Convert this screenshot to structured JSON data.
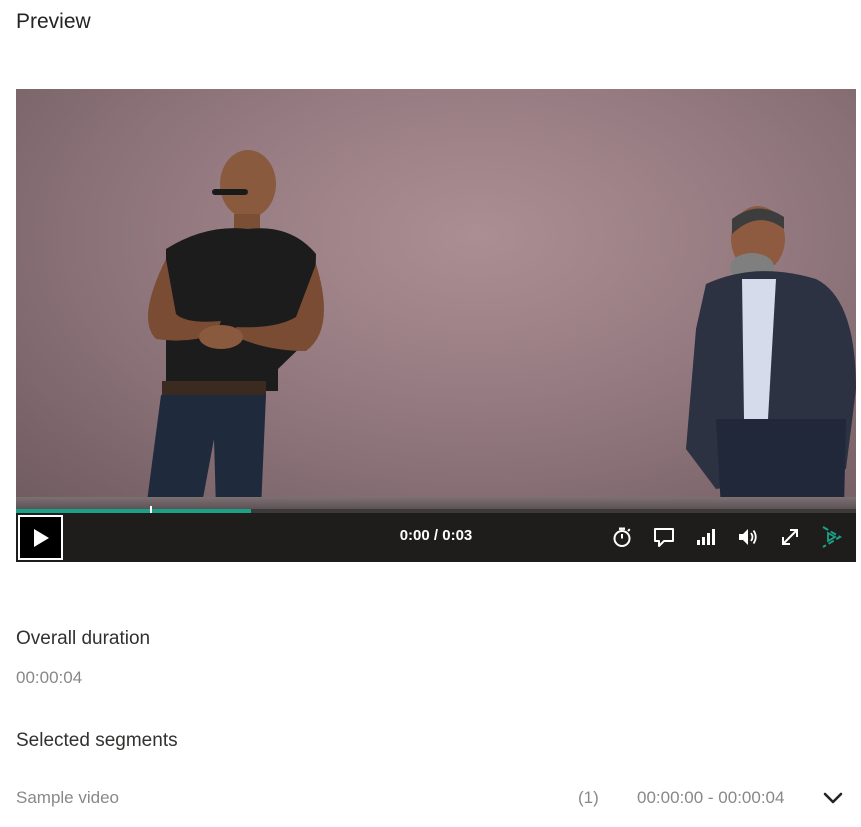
{
  "page": {
    "title": "Preview"
  },
  "player": {
    "time_display": "0:00 / 0:03",
    "progress_fraction": 0.16,
    "buffered_fraction": 0.28,
    "accent_color": "#1aa286",
    "controls": [
      {
        "name": "timer-icon",
        "label": "Timer"
      },
      {
        "name": "captions-icon",
        "label": "Captions"
      },
      {
        "name": "quality-icon",
        "label": "Quality"
      },
      {
        "name": "volume-icon",
        "label": "Volume"
      },
      {
        "name": "fullscreen-icon",
        "label": "Fullscreen"
      },
      {
        "name": "playback-speed-icon",
        "label": "Playback"
      }
    ]
  },
  "overall": {
    "label": "Overall duration",
    "value": "00:00:04"
  },
  "segments": {
    "label": "Selected segments",
    "items": [
      {
        "name": "Sample video",
        "count": "(1)",
        "range": "00:00:00 - 00:00:04"
      }
    ]
  }
}
